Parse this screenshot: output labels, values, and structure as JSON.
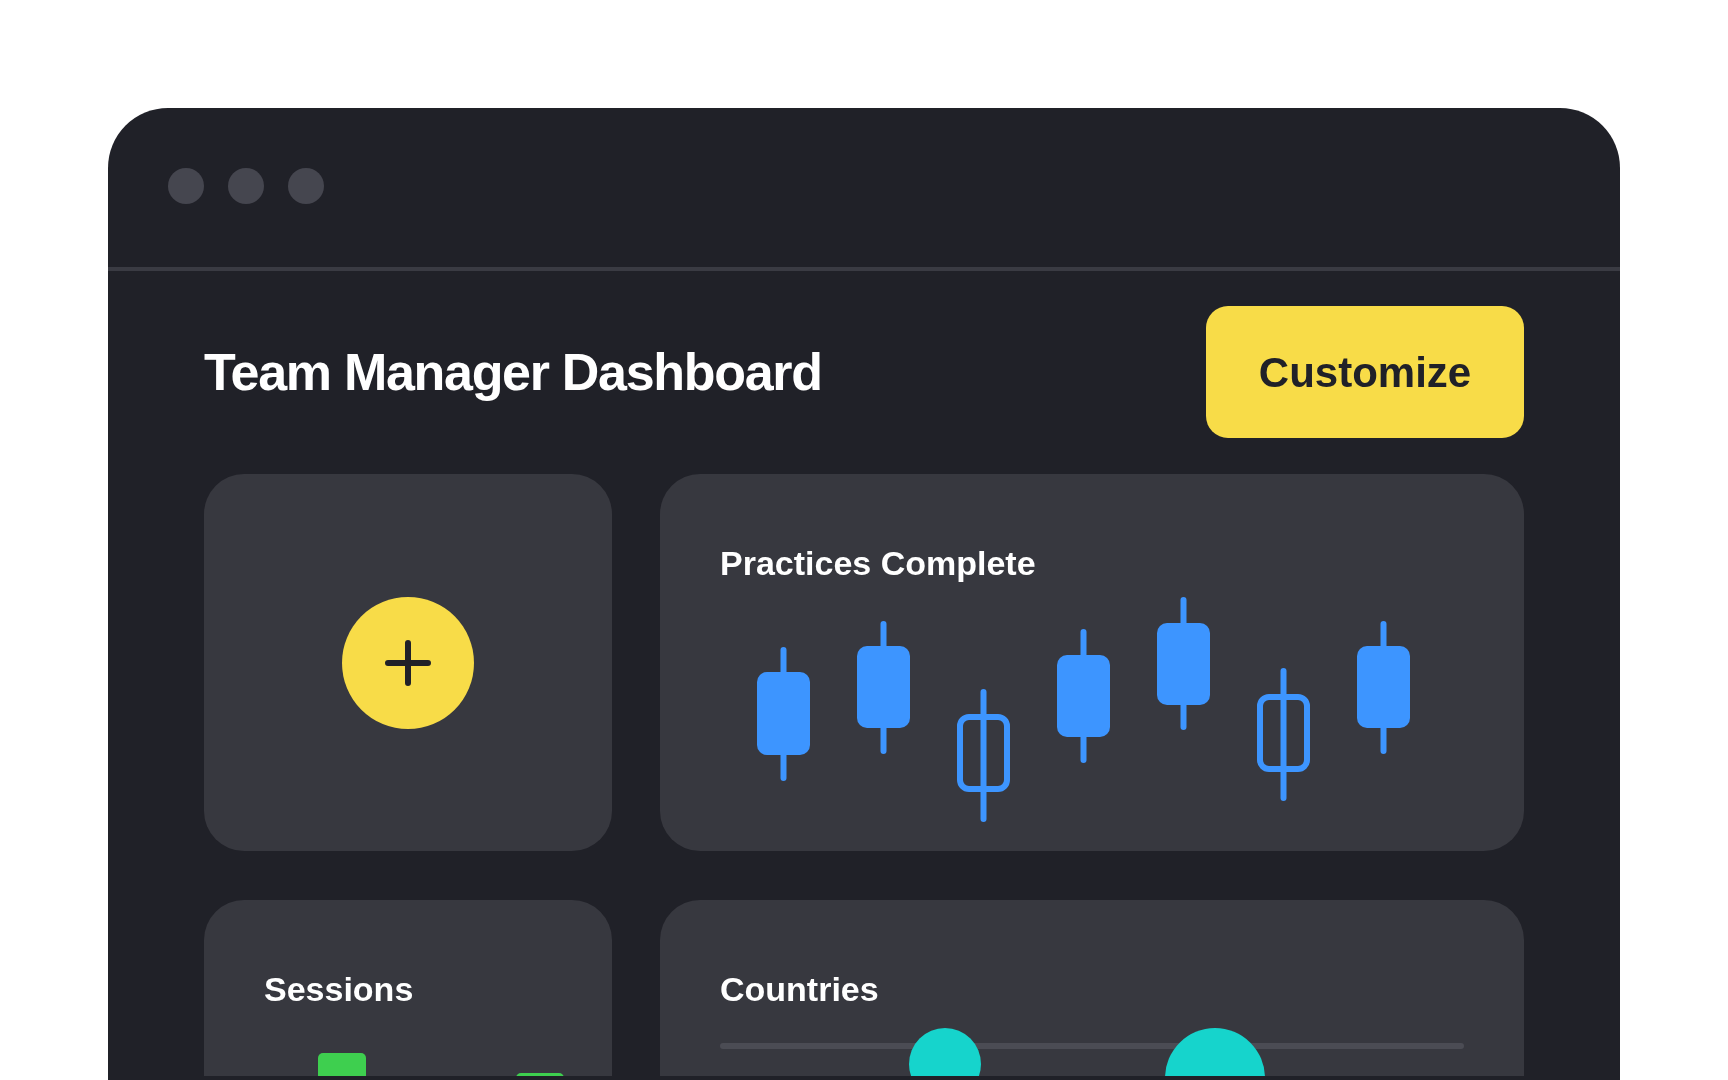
{
  "header": {
    "title": "Team Manager Dashboard",
    "action": "Customize"
  },
  "cards": [
    {
      "kind": "add"
    },
    {
      "kind": "candles",
      "title": "Practices Complete"
    },
    {
      "kind": "bars",
      "title": "Sessions"
    },
    {
      "kind": "track",
      "title": "Countries"
    }
  ]
}
